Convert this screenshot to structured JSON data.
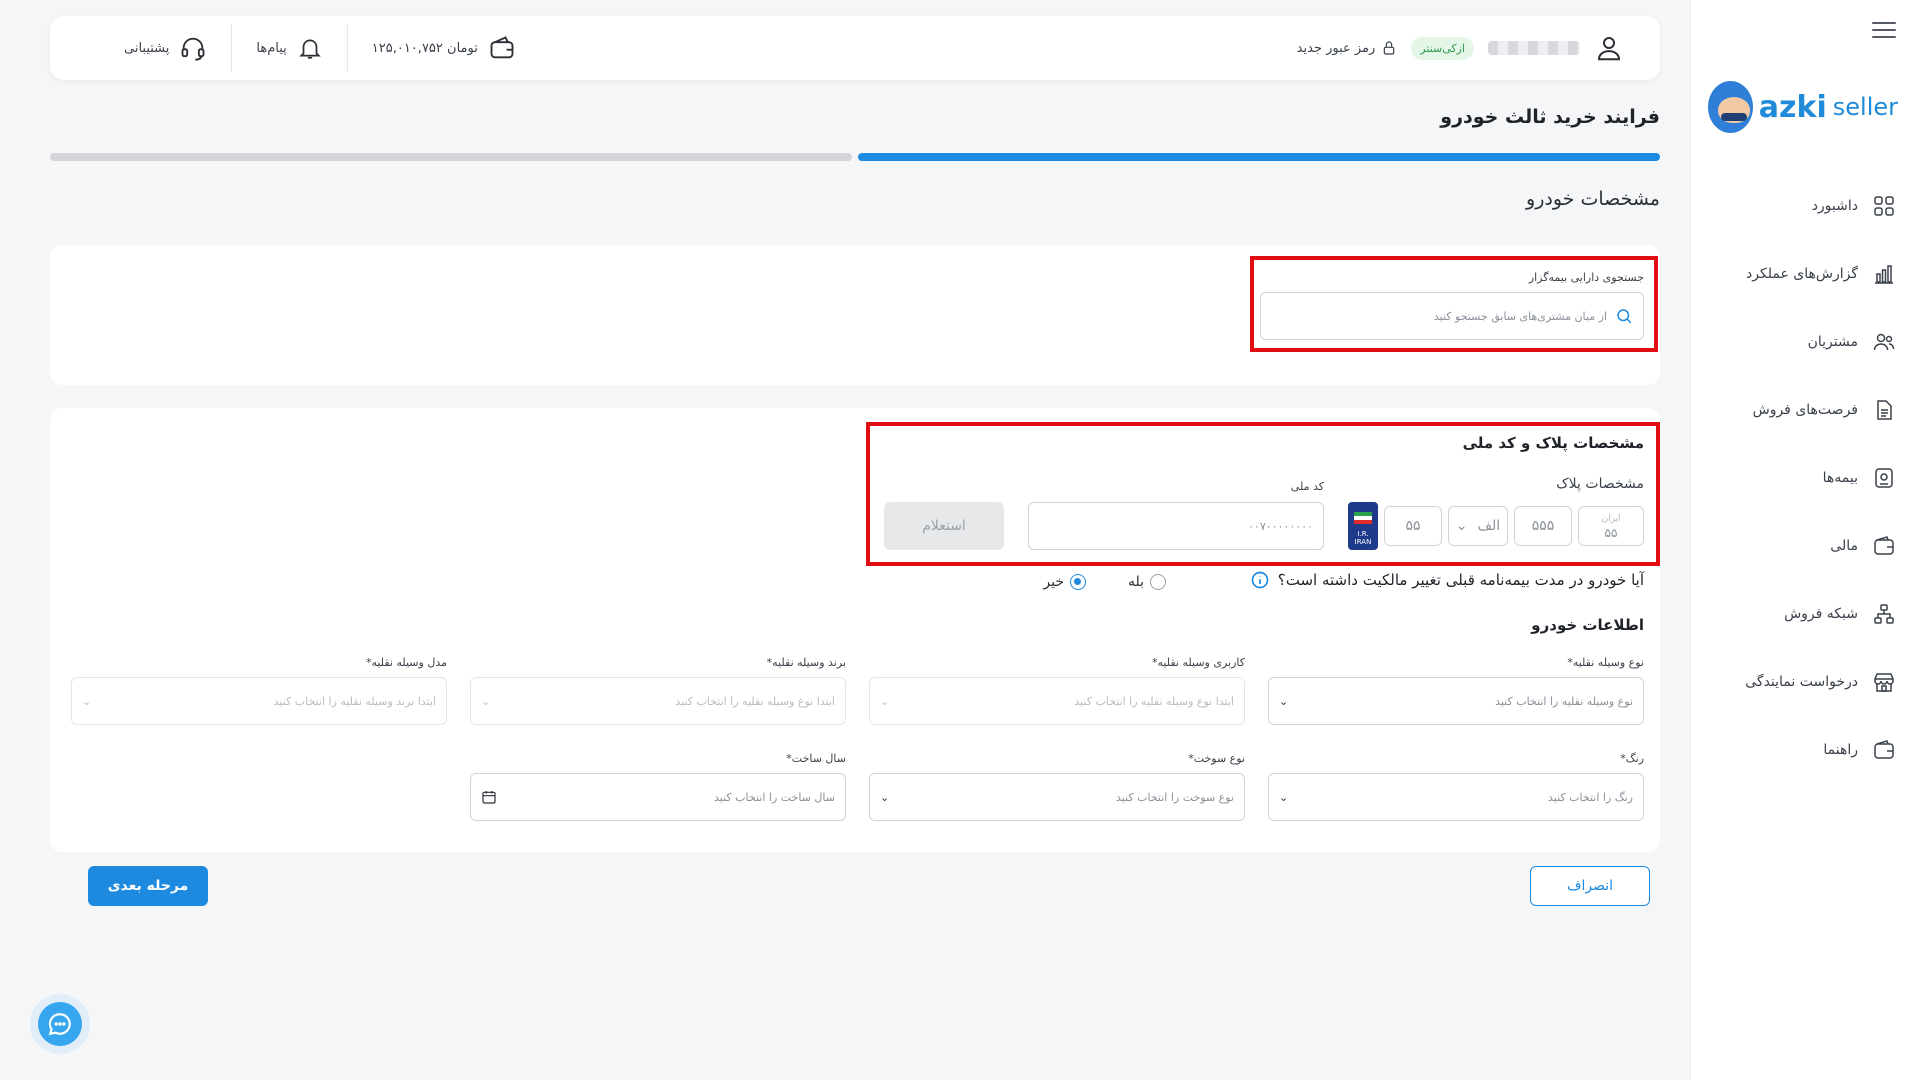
{
  "sidebar": {
    "brand": {
      "part1": "azki",
      "part2": "seller"
    },
    "items": [
      {
        "label": "داشبورد",
        "icon": "dashboard-icon"
      },
      {
        "label": "گزارش‌های عملکرد",
        "icon": "bar-chart-icon"
      },
      {
        "label": "مشتریان",
        "icon": "users-icon"
      },
      {
        "label": "فرصت‌های فروش",
        "icon": "document-icon"
      },
      {
        "label": "بیمه‌ها",
        "icon": "insurance-icon"
      },
      {
        "label": "مالی",
        "icon": "wallet-icon"
      },
      {
        "label": "شبکه فروش",
        "icon": "network-icon"
      },
      {
        "label": "درخواست نمایندگی",
        "icon": "store-icon"
      },
      {
        "label": "راهنما",
        "icon": "help-icon"
      }
    ]
  },
  "topbar": {
    "badge": "ازکی‌سنتر",
    "new_password": "رمز عبور جدید",
    "balance": "۱۲۵,۰۱۰,۷۵۲ تومان",
    "messages": "پیام‌ها",
    "support": "پشتیبانی"
  },
  "page": {
    "title": "فرایند خرید ثالث خودرو",
    "progress_percent": 50,
    "section_title": "مشخصات خودرو"
  },
  "search": {
    "label": "جستجوی دارایی بیمه‌گزار",
    "placeholder": "از میان مشتری‌های سابق جستجو کنید"
  },
  "plate_section": {
    "title": "مشخصات پلاک و کد ملی",
    "plate_label": "مشخصات پلاک",
    "plate_iran_label": "ایران",
    "plate_iran": "۵۵",
    "plate_three": "۵۵۵",
    "plate_letter": "الف",
    "plate_two": "۵۵",
    "flag_text1": "I.R.",
    "flag_text2": "IRAN",
    "national_code_label": "کد ملی",
    "national_code_placeholder": "۰۰۷۰۰۰۰۰۰۰۰",
    "inquiry_button": "استعلام"
  },
  "ownership": {
    "question": "آیا خودرو در مدت بیمه‌نامه قبلی تغییر مالکیت داشته است؟",
    "yes": "بله",
    "no": "خیر",
    "selected": "no"
  },
  "vehicle_info": {
    "title": "اطلاعات خودرو",
    "fields": [
      {
        "label": "نوع وسیله نقلیه*",
        "placeholder": "نوع وسیله نقلیه را انتخاب کنید"
      },
      {
        "label": "کاربری وسیله نقلیه*",
        "placeholder": "ابتدا نوع وسیله نقلیه را انتخاب کنید"
      },
      {
        "label": "برند وسیله نقلیه*",
        "placeholder": "ابتدا نوع وسیله نقلیه را انتخاب کنید"
      },
      {
        "label": "مدل وسیله نقلیه*",
        "placeholder": "ابتدا برند وسیله نقلیه را انتخاب کنید"
      },
      {
        "label": "رنگ*",
        "placeholder": "رنگ را انتخاب کنید"
      },
      {
        "label": "نوع سوخت*",
        "placeholder": "نوع سوخت را انتخاب کنید"
      },
      {
        "label": "سال ساخت*",
        "placeholder": "سال ساخت را انتخاب کنید"
      }
    ]
  },
  "actions": {
    "next": "مرحله بعدی",
    "cancel": "انصراف"
  },
  "colors": {
    "primary": "#1d8ae0",
    "highlight": "#e10b12"
  }
}
